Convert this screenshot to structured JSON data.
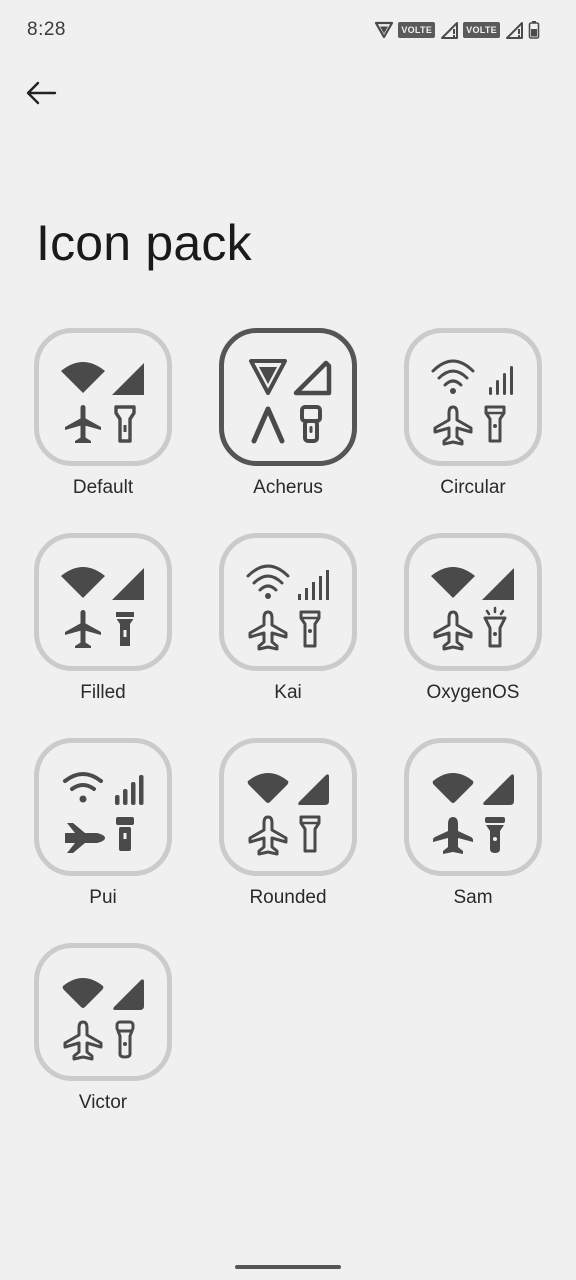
{
  "status_bar": {
    "time": "8:28",
    "network_badges": [
      "VOLTE",
      "VOLTE"
    ],
    "icons": [
      "wifi-icon",
      "volte-badge",
      "cell-signal-icon",
      "volte-badge",
      "cell-signal-icon",
      "battery-icon"
    ]
  },
  "header": {
    "back_icon": "arrow-left-icon",
    "title": "Icon pack"
  },
  "icon_packs": [
    {
      "label": "Default",
      "selected": false
    },
    {
      "label": "Acherus",
      "selected": true
    },
    {
      "label": "Circular",
      "selected": false
    },
    {
      "label": "Filled",
      "selected": false
    },
    {
      "label": "Kai",
      "selected": false
    },
    {
      "label": "OxygenOS",
      "selected": false
    },
    {
      "label": "Pui",
      "selected": false
    },
    {
      "label": "Rounded",
      "selected": false
    },
    {
      "label": "Sam",
      "selected": false
    },
    {
      "label": "Victor",
      "selected": false
    }
  ],
  "preview_icons": [
    "wifi-icon",
    "cell-signal-icon",
    "airplane-icon",
    "flashlight-icon"
  ],
  "colors": {
    "background": "#f0f0f0",
    "tile_border": "#cbcbcb",
    "tile_border_selected": "#555555",
    "icon": "#4a4a4a"
  }
}
